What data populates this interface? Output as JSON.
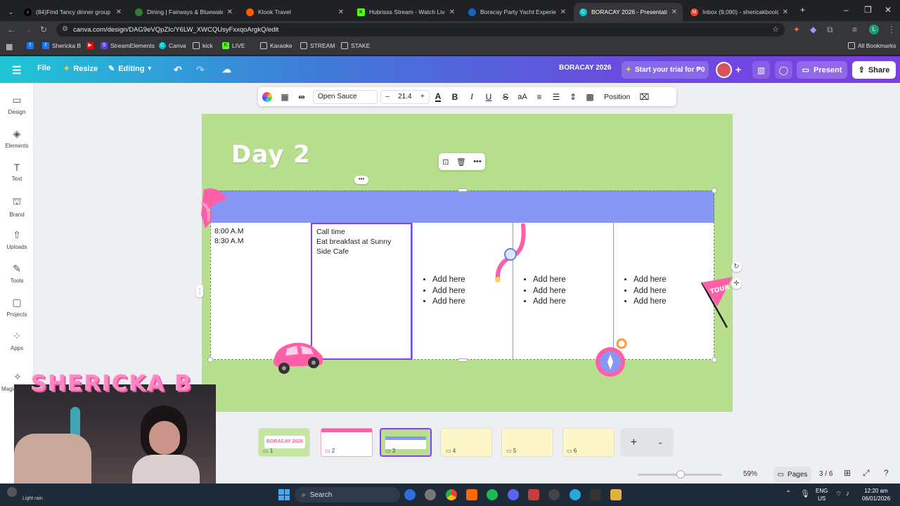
{
  "browser": {
    "tabs": [
      {
        "title": "(84)Find 'fancy dinner group bo",
        "icon": "tiktok-icon",
        "color": "#000000",
        "active": false
      },
      {
        "title": "Dining | Fairways & Bluewater B",
        "icon": "globe-icon",
        "color": "#2e7d32",
        "active": false
      },
      {
        "title": "Klook Travel",
        "icon": "klook-icon",
        "color": "#ff5b00",
        "active": false
      },
      {
        "title": "Hubrisss Stream - Watch Live o",
        "icon": "kick-icon",
        "color": "#53fc18",
        "active": false
      },
      {
        "title": "Boracay Party Yacht Experience",
        "icon": "globe-icon",
        "color": "#1565c0",
        "active": false
      },
      {
        "title": "BORACAY 2026 - Presentation",
        "icon": "canva-icon",
        "color": "#00c4cc",
        "active": true
      },
      {
        "title": "Inbox (9,090) - shericakbool@g",
        "icon": "gmail-icon",
        "color": "#ea4335",
        "active": false
      }
    ],
    "url": "canva.com/design/DAG9eVQpZIc/Y6LW_XWCQUsyFxxqoArgkQ/edit",
    "profile_initial": "L",
    "bookmarks": [
      "Shericka B",
      "StreamElements",
      "Canva",
      "kick",
      "LIVE",
      "Karaoke",
      "STREAM",
      "STAKE"
    ],
    "all_bookmarks": "All Bookmarks"
  },
  "canva": {
    "file_label": "File",
    "resize_label": "Resize",
    "editing_label": "Editing",
    "doc_title": "BORACAY 2026",
    "trial_label": "Start your trial for ₱0",
    "present_label": "Present",
    "share_label": "Share",
    "sidebar": [
      {
        "label": "Design",
        "icon": "design-icon"
      },
      {
        "label": "Elements",
        "icon": "elements-icon"
      },
      {
        "label": "Text",
        "icon": "text-icon"
      },
      {
        "label": "Brand",
        "icon": "brand-icon"
      },
      {
        "label": "Uploads",
        "icon": "uploads-icon"
      },
      {
        "label": "Tools",
        "icon": "tools-icon"
      },
      {
        "label": "Projects",
        "icon": "projects-icon"
      },
      {
        "label": "Apps",
        "icon": "apps-icon"
      },
      {
        "label": "Magic",
        "icon": "magic-icon"
      }
    ],
    "toolbar": {
      "font": "Open Sauce",
      "size": "21.4",
      "position_label": "Position"
    },
    "slide": {
      "title": "Day 2",
      "time_cell": [
        "8:00 A.M",
        "8:30 A.M"
      ],
      "activity_cell": [
        "Call time",
        "Eat breakfast at Sunny",
        "Side Cafe"
      ],
      "bullet_label": "Add here",
      "sticker_text": "TOUR"
    },
    "pages": {
      "thumb_title": "BORACAY 2026",
      "count": [
        "1",
        "2",
        "3",
        "4",
        "5",
        "6"
      ],
      "current": "3 / 6",
      "pages_label": "Pages",
      "zoom": "59%"
    }
  },
  "webcam": {
    "overlay_name": "SHERICKA B"
  },
  "taskbar": {
    "weather": "Light rain",
    "search_label": "Search",
    "lang": "ENG",
    "region": "US",
    "time": "12:20 am",
    "date": "06/01/2026"
  }
}
